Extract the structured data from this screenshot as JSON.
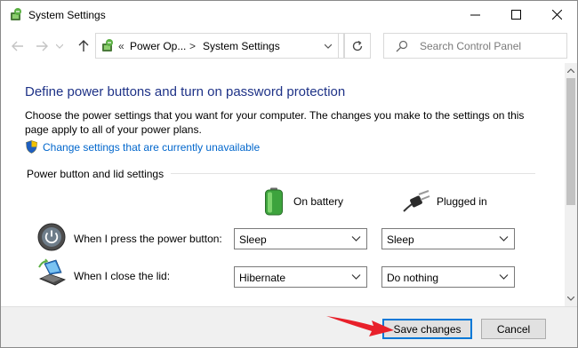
{
  "window": {
    "title": "System Settings"
  },
  "address_bar": {
    "separator": "«",
    "crumbs": [
      "Power Op...",
      "System Settings"
    ],
    "crumb_separator": ">"
  },
  "search": {
    "placeholder": "Search Control Panel"
  },
  "page": {
    "heading": "Define power buttons and turn on password protection",
    "description": "Choose the power settings that you want for your computer. The changes you make to the settings on this page apply to all of your power plans.",
    "unavailable_link": "Change settings that are currently unavailable"
  },
  "section": {
    "label": "Power button and lid settings",
    "columns": {
      "battery": "On battery",
      "plugged": "Plugged in"
    },
    "rows": [
      {
        "label": "When I press the power button:",
        "battery": "Sleep",
        "plugged": "Sleep"
      },
      {
        "label": "When I close the lid:",
        "battery": "Hibernate",
        "plugged": "Do nothing"
      }
    ]
  },
  "footer": {
    "save_label": "Save changes",
    "cancel_label": "Cancel"
  },
  "colors": {
    "heading": "#1e3287",
    "link": "#0066cc",
    "accent_focus": "#0078d7",
    "arrow": "#e8202a"
  },
  "icons": {
    "app": "power-options-icon",
    "shield": "uac-shield-icon",
    "battery": "battery-icon",
    "plug": "plug-icon",
    "power_button": "power-button-icon",
    "lid": "laptop-lid-icon"
  }
}
